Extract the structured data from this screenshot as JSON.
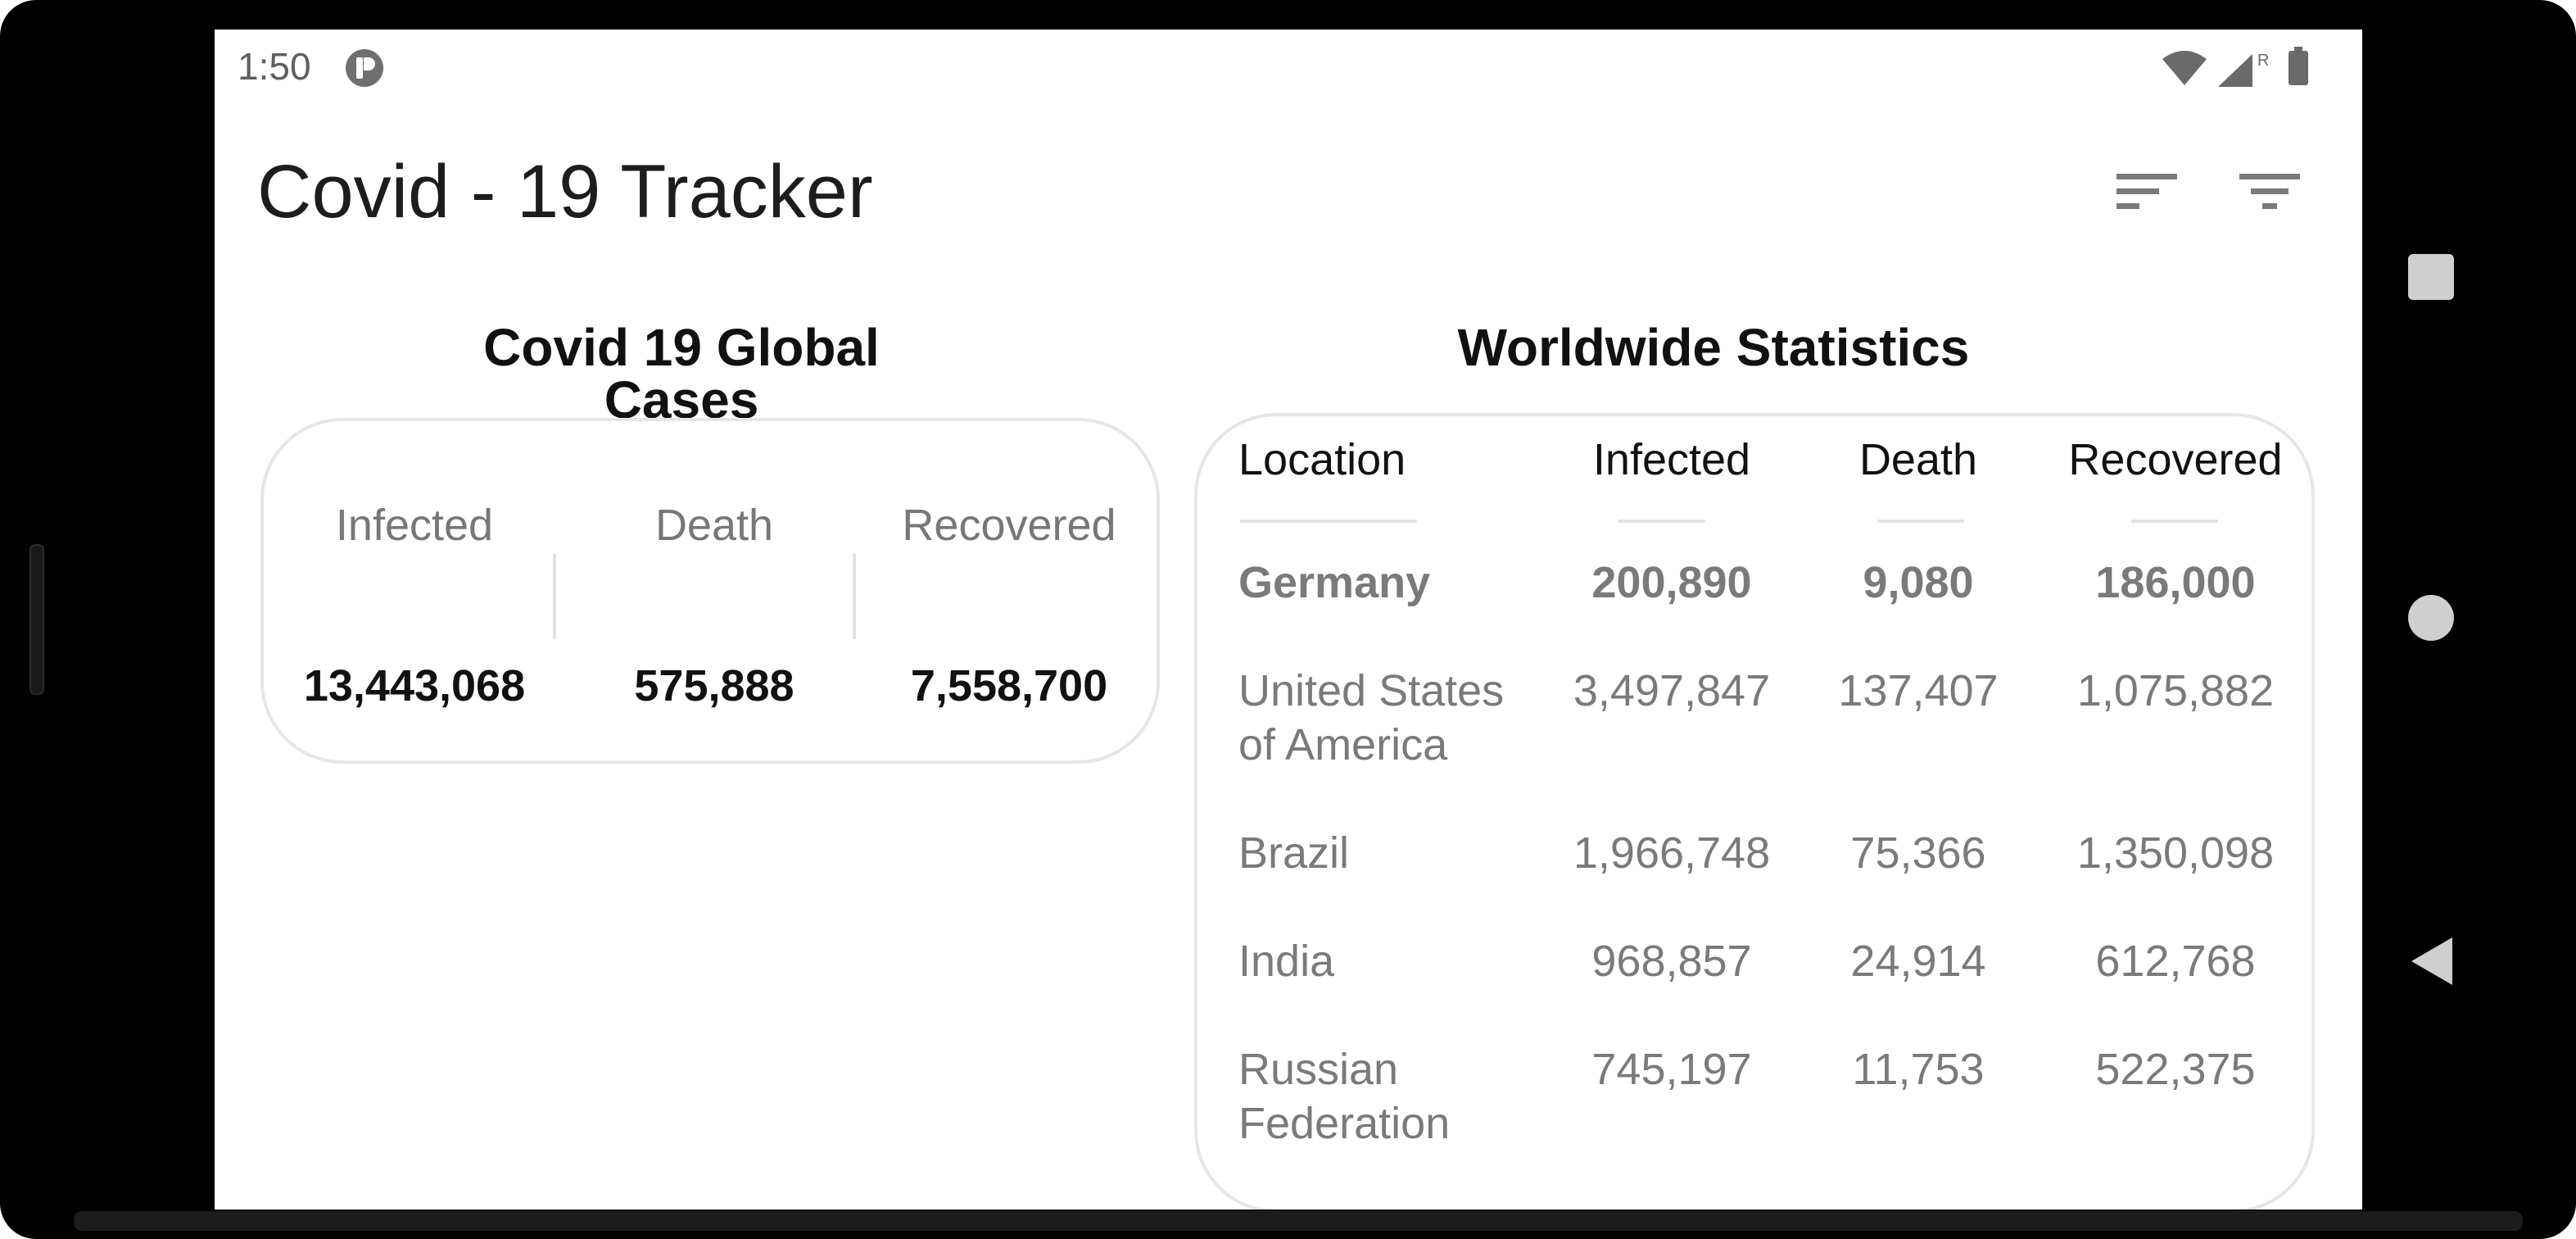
{
  "status_bar": {
    "time": "1:50",
    "app_icon": "tracker-app-icon",
    "signal_roaming_label": "R",
    "icons": [
      "wifi-icon",
      "signal-icon",
      "battery-icon"
    ]
  },
  "app_bar": {
    "title": "Covid - 19 Tracker",
    "actions": [
      "sort-icon",
      "filter-icon"
    ]
  },
  "global_cases": {
    "heading": "Covid 19 Global Cases",
    "columns": [
      {
        "label": "Infected",
        "value": "13,443,068"
      },
      {
        "label": "Death",
        "value": "575,888"
      },
      {
        "label": "Recovered",
        "value": "7,558,700"
      }
    ]
  },
  "worldwide": {
    "heading": "Worldwide Statistics",
    "headers": [
      "Location",
      "Infected",
      "Death",
      "Recovered"
    ],
    "rows": [
      {
        "location": "Germany",
        "infected": "200,890",
        "death": "9,080",
        "recovered": "186,000",
        "bold": true
      },
      {
        "location": "United States of America",
        "infected": "3,497,847",
        "death": "137,407",
        "recovered": "1,075,882",
        "bold": false
      },
      {
        "location": "Brazil",
        "infected": "1,966,748",
        "death": "75,366",
        "recovered": "1,350,098",
        "bold": false
      },
      {
        "location": "India",
        "infected": "968,857",
        "death": "24,914",
        "recovered": "612,768",
        "bold": false
      },
      {
        "location": "Russian Federation",
        "infected": "745,197",
        "death": "11,753",
        "recovered": "522,375",
        "bold": false
      }
    ]
  },
  "nav_bar": {
    "icons": [
      "recents-icon",
      "home-icon",
      "back-icon"
    ]
  },
  "colors": {
    "background": "#ffffff",
    "frame": "#000000",
    "text_primary": "#111111",
    "text_secondary": "#7a7a7a",
    "card_border": "#e6e6e6"
  }
}
